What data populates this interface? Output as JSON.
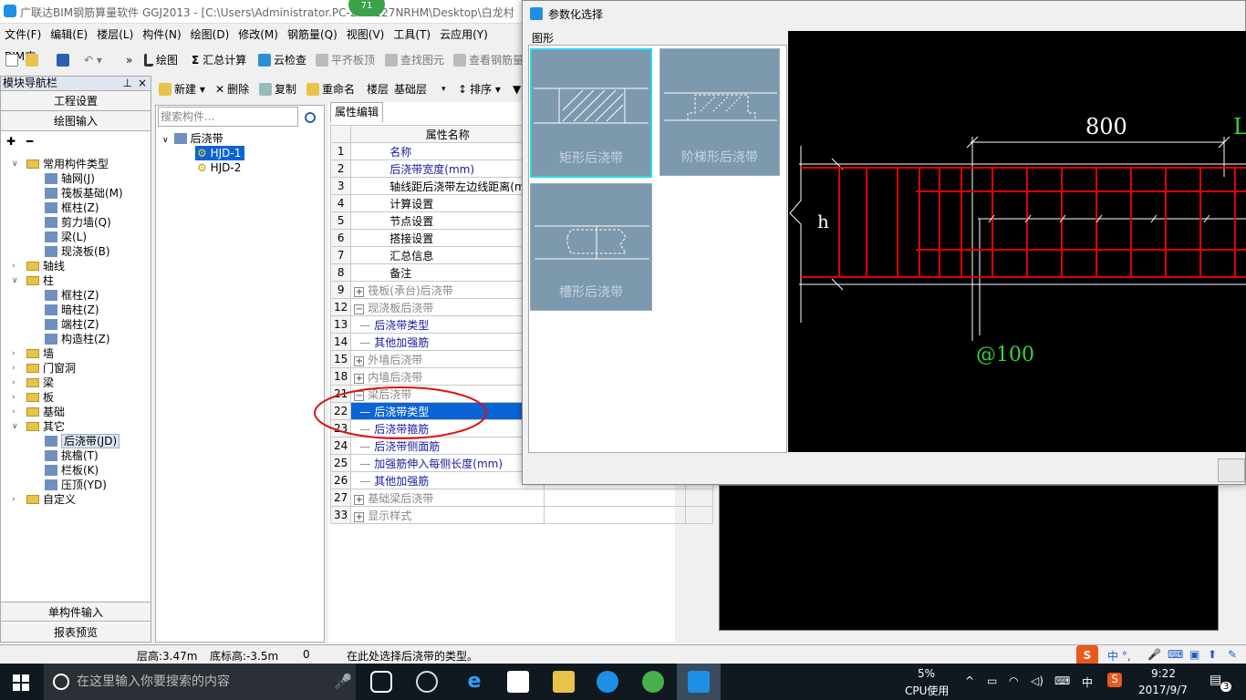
{
  "window": {
    "title": "广联达BIM钢筋算量软件 GGJ2013 - [C:\\Users\\Administrator.PC-20...127NRHM\\Desktop\\白龙村",
    "badge": "71"
  },
  "menu": [
    "文件(F)",
    "编辑(E)",
    "楼层(L)",
    "构件(N)",
    "绘图(D)",
    "修改(M)",
    "钢筋量(Q)",
    "视图(V)",
    "工具(T)",
    "云应用(Y)",
    "BIM应"
  ],
  "toolbar": {
    "draw": "绘图",
    "sum": "汇总计算",
    "cloud_check": "云检查",
    "flat_top": "平齐板顶",
    "find": "查找图元",
    "view_rebar": "查看钢筋量"
  },
  "nav": {
    "title": "模块导航栏",
    "pin": "⊥",
    "close": "×",
    "project_settings": "工程设置",
    "draw_input": "绘图输入",
    "single_input": "单构件输入",
    "report_preview": "报表预览",
    "tree": [
      {
        "label": "常用构件类型",
        "level": 0,
        "exp": "∨",
        "kind": "folder"
      },
      {
        "label": "轴网(J)",
        "level": 1,
        "kind": "item"
      },
      {
        "label": "筏板基础(M)",
        "level": 1,
        "kind": "item"
      },
      {
        "label": "框柱(Z)",
        "level": 1,
        "kind": "item"
      },
      {
        "label": "剪力墙(Q)",
        "level": 1,
        "kind": "item"
      },
      {
        "label": "梁(L)",
        "level": 1,
        "kind": "item"
      },
      {
        "label": "现浇板(B)",
        "level": 1,
        "kind": "item"
      },
      {
        "label": "轴线",
        "level": 0,
        "exp": "›",
        "kind": "folder"
      },
      {
        "label": "柱",
        "level": 0,
        "exp": "∨",
        "kind": "folder"
      },
      {
        "label": "框柱(Z)",
        "level": 1,
        "kind": "item"
      },
      {
        "label": "暗柱(Z)",
        "level": 1,
        "kind": "item"
      },
      {
        "label": "端柱(Z)",
        "level": 1,
        "kind": "item"
      },
      {
        "label": "构造柱(Z)",
        "level": 1,
        "kind": "item"
      },
      {
        "label": "墙",
        "level": 0,
        "exp": "›",
        "kind": "folder"
      },
      {
        "label": "门窗洞",
        "level": 0,
        "exp": "›",
        "kind": "folder"
      },
      {
        "label": "梁",
        "level": 0,
        "exp": "›",
        "kind": "folder"
      },
      {
        "label": "板",
        "level": 0,
        "exp": "›",
        "kind": "folder"
      },
      {
        "label": "基础",
        "level": 0,
        "exp": "›",
        "kind": "folder"
      },
      {
        "label": "其它",
        "level": 0,
        "exp": "∨",
        "kind": "folder"
      },
      {
        "label": "后浇带(JD)",
        "level": 1,
        "kind": "item",
        "selected": true
      },
      {
        "label": "挑檐(T)",
        "level": 1,
        "kind": "item"
      },
      {
        "label": "栏板(K)",
        "level": 1,
        "kind": "item"
      },
      {
        "label": "压顶(YD)",
        "level": 1,
        "kind": "item"
      },
      {
        "label": "自定义",
        "level": 0,
        "exp": "›",
        "kind": "folder"
      }
    ]
  },
  "component_toolbar": {
    "new": "新建",
    "delete": "删除",
    "copy": "复制",
    "rename": "重命名",
    "floor_label": "楼层",
    "floor_value": "基础层",
    "sort": "排序"
  },
  "component_tree": {
    "search_placeholder": "搜索构件...",
    "root": "后浇带",
    "items": [
      "HJD-1",
      "HJD-2"
    ]
  },
  "props": {
    "tab": "属性编辑",
    "header": "属性名称",
    "rows": [
      {
        "n": "1",
        "label": "名称",
        "style": "blue"
      },
      {
        "n": "2",
        "label": "后浇带宽度(mm)",
        "style": "blue"
      },
      {
        "n": "3",
        "label": "轴线距后浇带左边线距离(mm)",
        "style": "plain"
      },
      {
        "n": "4",
        "label": "计算设置",
        "style": "plain"
      },
      {
        "n": "5",
        "label": "节点设置",
        "style": "plain"
      },
      {
        "n": "6",
        "label": "搭接设置",
        "style": "plain"
      },
      {
        "n": "7",
        "label": "汇总信息",
        "style": "plain"
      },
      {
        "n": "8",
        "label": "备注",
        "style": "plain"
      },
      {
        "n": "9",
        "label": "筏板(承台)后浇带",
        "style": "gray",
        "tog": "+"
      },
      {
        "n": "12",
        "label": "现浇板后浇带",
        "style": "gray",
        "tog": "−"
      },
      {
        "n": "13",
        "label": "后浇带类型",
        "style": "blue",
        "child": true
      },
      {
        "n": "14",
        "label": "其他加强筋",
        "style": "blue",
        "child": true
      },
      {
        "n": "15",
        "label": "外墙后浇带",
        "style": "gray",
        "tog": "+"
      },
      {
        "n": "18",
        "label": "内墙后浇带",
        "style": "gray",
        "tog": "+"
      },
      {
        "n": "21",
        "label": "梁后浇带",
        "style": "gray",
        "tog": "−"
      },
      {
        "n": "22",
        "label": "后浇带类型",
        "style": "blue",
        "child": true,
        "selected": true
      },
      {
        "n": "23",
        "label": "后浇带箍筋",
        "style": "blue",
        "child": true
      },
      {
        "n": "24",
        "label": "后浇带侧面筋",
        "style": "blue",
        "child": true
      },
      {
        "n": "25",
        "label": "加强筋伸入每侧长度(mm)",
        "style": "blue",
        "child": true
      },
      {
        "n": "26",
        "label": "其他加强筋",
        "style": "blue",
        "child": true
      },
      {
        "n": "27",
        "label": "基础梁后浇带",
        "style": "gray",
        "tog": "+"
      },
      {
        "n": "33",
        "label": "显示样式",
        "style": "gray",
        "tog": "+"
      }
    ]
  },
  "dialog": {
    "title": "参数化选择",
    "group": "图形",
    "options": [
      {
        "label": "矩形后浇带",
        "selected": true
      },
      {
        "label": "阶梯形后浇带"
      },
      {
        "label": "槽形后浇带"
      }
    ],
    "preview": {
      "width_label": "800",
      "spacing_label": "@100",
      "height_label": "h",
      "edge_label": "L"
    }
  },
  "status": {
    "floor_height": "层高:3.47m",
    "bottom_height": "底标高:-3.5m",
    "zero": "0",
    "hint": "在此处选择后浇带的类型。"
  },
  "taskbar": {
    "search": "在这里输入你要搜索的内容",
    "cpu": "5%",
    "cpu_label": "CPU使用",
    "ime": "中",
    "time": "9:22",
    "date": "2017/9/7",
    "notif": "3",
    "ime_tray": "中 °,"
  },
  "colors": {
    "selection": "#0a64d6",
    "rebar": "#e00000",
    "dim": "#ffffff",
    "label_green": "#36d33a",
    "tile": "#7d99ad"
  }
}
